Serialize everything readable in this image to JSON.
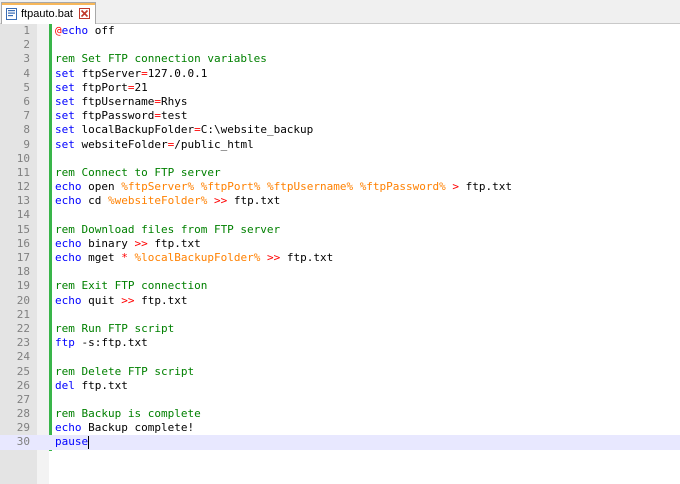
{
  "tab": {
    "filename": "ftpauto.bat",
    "icon": "save-file-icon",
    "close_icon": "close-icon"
  },
  "colors": {
    "keyword": "#0000ff",
    "comment": "#008000",
    "variable": "#ff8000",
    "operator": "#ff0000",
    "change_bar": "#39b54a",
    "current_line": "#e8e8ff"
  },
  "editor": {
    "current_line": 30,
    "lines": [
      {
        "n": "1",
        "tokens": [
          {
            "t": "@",
            "c": "op"
          },
          {
            "t": "echo",
            "c": "kw"
          },
          {
            "t": " off",
            "c": ""
          }
        ]
      },
      {
        "n": "2",
        "tokens": []
      },
      {
        "n": "3",
        "tokens": [
          {
            "t": "rem Set FTP connection variables",
            "c": "cmt"
          }
        ]
      },
      {
        "n": "4",
        "tokens": [
          {
            "t": "set",
            "c": "kw"
          },
          {
            "t": " ftpServer",
            "c": ""
          },
          {
            "t": "=",
            "c": "op"
          },
          {
            "t": "127.0.0.1",
            "c": ""
          }
        ]
      },
      {
        "n": "5",
        "tokens": [
          {
            "t": "set",
            "c": "kw"
          },
          {
            "t": " ftpPort",
            "c": ""
          },
          {
            "t": "=",
            "c": "op"
          },
          {
            "t": "21",
            "c": ""
          }
        ]
      },
      {
        "n": "6",
        "tokens": [
          {
            "t": "set",
            "c": "kw"
          },
          {
            "t": " ftpUsername",
            "c": ""
          },
          {
            "t": "=",
            "c": "op"
          },
          {
            "t": "Rhys",
            "c": ""
          }
        ]
      },
      {
        "n": "7",
        "tokens": [
          {
            "t": "set",
            "c": "kw"
          },
          {
            "t": " ftpPassword",
            "c": ""
          },
          {
            "t": "=",
            "c": "op"
          },
          {
            "t": "test",
            "c": ""
          }
        ]
      },
      {
        "n": "8",
        "tokens": [
          {
            "t": "set",
            "c": "kw"
          },
          {
            "t": " localBackupFolder",
            "c": ""
          },
          {
            "t": "=",
            "c": "op"
          },
          {
            "t": "C:\\website_backup",
            "c": ""
          }
        ]
      },
      {
        "n": "9",
        "tokens": [
          {
            "t": "set",
            "c": "kw"
          },
          {
            "t": " websiteFolder",
            "c": ""
          },
          {
            "t": "=",
            "c": "op"
          },
          {
            "t": "/public_html",
            "c": ""
          }
        ]
      },
      {
        "n": "10",
        "tokens": []
      },
      {
        "n": "11",
        "tokens": [
          {
            "t": "rem Connect to FTP server",
            "c": "cmt"
          }
        ]
      },
      {
        "n": "12",
        "tokens": [
          {
            "t": "echo",
            "c": "kw"
          },
          {
            "t": " open ",
            "c": ""
          },
          {
            "t": "%ftpServer%",
            "c": "var"
          },
          {
            "t": " ",
            "c": ""
          },
          {
            "t": "%ftpPort%",
            "c": "var"
          },
          {
            "t": " ",
            "c": ""
          },
          {
            "t": "%ftpUsername%",
            "c": "var"
          },
          {
            "t": " ",
            "c": ""
          },
          {
            "t": "%ftpPassword%",
            "c": "var"
          },
          {
            "t": " ",
            "c": ""
          },
          {
            "t": ">",
            "c": "op"
          },
          {
            "t": " ftp.txt",
            "c": ""
          }
        ]
      },
      {
        "n": "13",
        "tokens": [
          {
            "t": "echo",
            "c": "kw"
          },
          {
            "t": " cd ",
            "c": ""
          },
          {
            "t": "%websiteFolder%",
            "c": "var"
          },
          {
            "t": " ",
            "c": ""
          },
          {
            "t": ">>",
            "c": "op"
          },
          {
            "t": " ftp.txt",
            "c": ""
          }
        ]
      },
      {
        "n": "14",
        "tokens": []
      },
      {
        "n": "15",
        "tokens": [
          {
            "t": "rem Download files from FTP server",
            "c": "cmt"
          }
        ]
      },
      {
        "n": "16",
        "tokens": [
          {
            "t": "echo",
            "c": "kw"
          },
          {
            "t": " binary ",
            "c": ""
          },
          {
            "t": ">>",
            "c": "op"
          },
          {
            "t": " ftp.txt",
            "c": ""
          }
        ]
      },
      {
        "n": "17",
        "tokens": [
          {
            "t": "echo",
            "c": "kw"
          },
          {
            "t": " mget ",
            "c": ""
          },
          {
            "t": "*",
            "c": "op"
          },
          {
            "t": " ",
            "c": ""
          },
          {
            "t": "%localBackupFolder%",
            "c": "var"
          },
          {
            "t": " ",
            "c": ""
          },
          {
            "t": ">>",
            "c": "op"
          },
          {
            "t": " ftp.txt",
            "c": ""
          }
        ]
      },
      {
        "n": "18",
        "tokens": []
      },
      {
        "n": "19",
        "tokens": [
          {
            "t": "rem Exit FTP connection",
            "c": "cmt"
          }
        ]
      },
      {
        "n": "20",
        "tokens": [
          {
            "t": "echo",
            "c": "kw"
          },
          {
            "t": " quit ",
            "c": ""
          },
          {
            "t": ">>",
            "c": "op"
          },
          {
            "t": " ftp.txt",
            "c": ""
          }
        ]
      },
      {
        "n": "21",
        "tokens": []
      },
      {
        "n": "22",
        "tokens": [
          {
            "t": "rem Run FTP script",
            "c": "cmt"
          }
        ]
      },
      {
        "n": "23",
        "tokens": [
          {
            "t": "ftp",
            "c": "kw"
          },
          {
            "t": " -s:ftp.txt",
            "c": ""
          }
        ]
      },
      {
        "n": "24",
        "tokens": []
      },
      {
        "n": "25",
        "tokens": [
          {
            "t": "rem Delete FTP script",
            "c": "cmt"
          }
        ]
      },
      {
        "n": "26",
        "tokens": [
          {
            "t": "del",
            "c": "kw"
          },
          {
            "t": " ftp.txt",
            "c": ""
          }
        ]
      },
      {
        "n": "27",
        "tokens": []
      },
      {
        "n": "28",
        "tokens": [
          {
            "t": "rem Backup is complete",
            "c": "cmt"
          }
        ]
      },
      {
        "n": "29",
        "tokens": [
          {
            "t": "echo",
            "c": "kw"
          },
          {
            "t": " Backup complete!",
            "c": ""
          }
        ]
      },
      {
        "n": "30",
        "tokens": [
          {
            "t": "pause",
            "c": "kw"
          }
        ]
      }
    ]
  }
}
